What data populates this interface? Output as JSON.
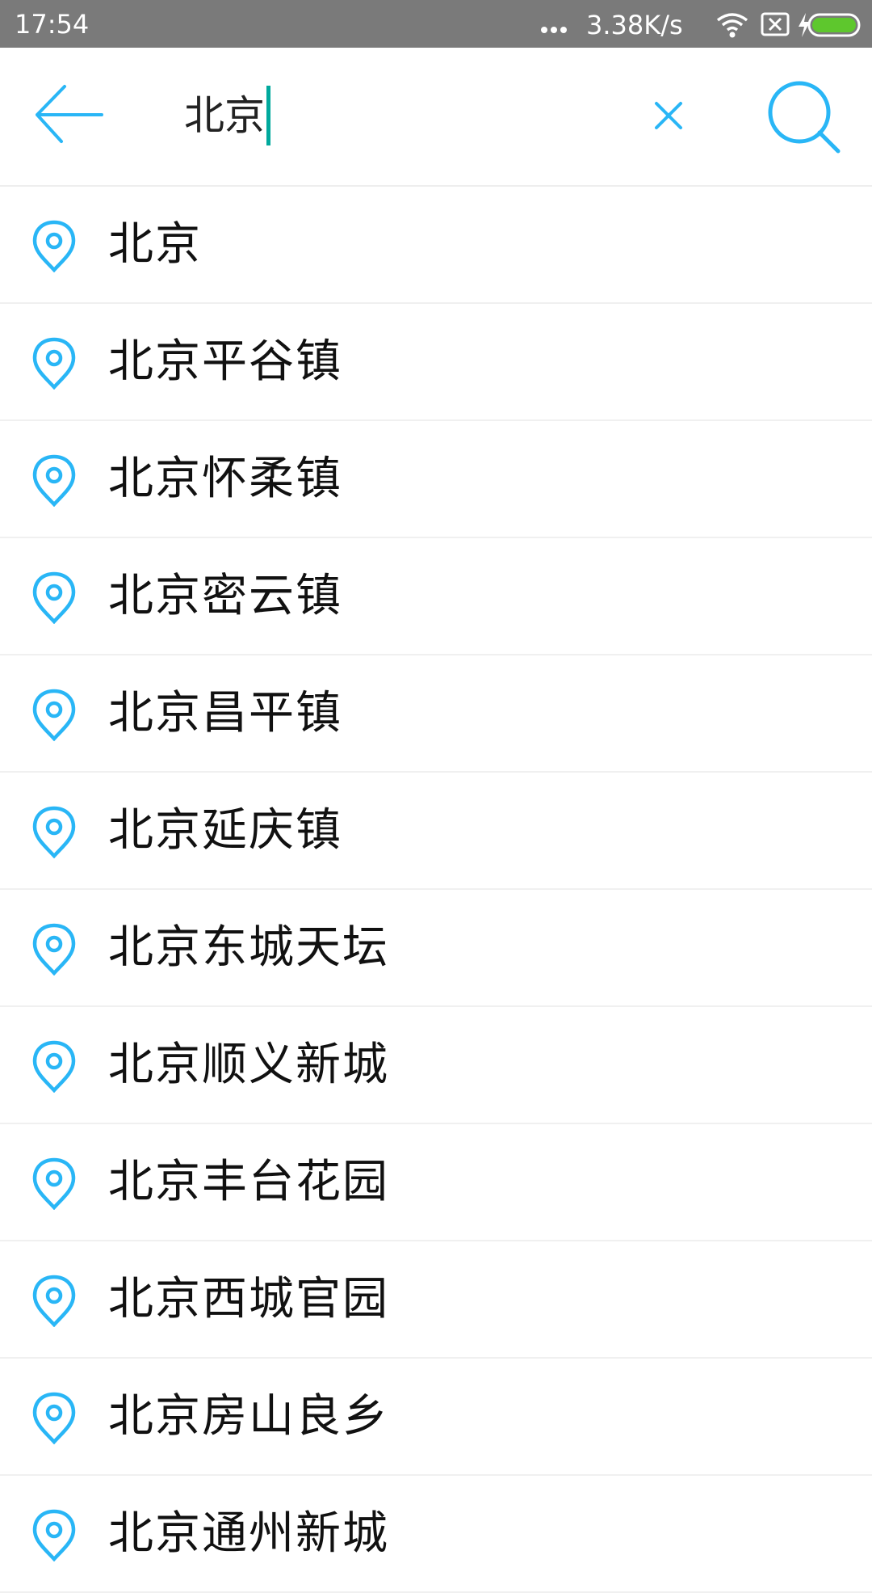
{
  "status_bar": {
    "time": "17:54",
    "network_speed": "3.38K/s",
    "icons": [
      "more-dots-icon",
      "wifi-icon",
      "sim-no-signal-icon",
      "charging-bolt-icon",
      "battery-icon"
    ],
    "battery_color": "#5ec72d"
  },
  "search": {
    "query": "北京",
    "back_icon": "arrow-left-icon",
    "clear_icon": "close-icon",
    "search_icon": "search-icon",
    "accent_color": "#29b6f6",
    "caret_color": "#00a99d"
  },
  "suggestions": [
    {
      "label": "北京",
      "icon": "location-pin-icon"
    },
    {
      "label": "北京平谷镇",
      "icon": "location-pin-icon"
    },
    {
      "label": "北京怀柔镇",
      "icon": "location-pin-icon"
    },
    {
      "label": "北京密云镇",
      "icon": "location-pin-icon"
    },
    {
      "label": "北京昌平镇",
      "icon": "location-pin-icon"
    },
    {
      "label": "北京延庆镇",
      "icon": "location-pin-icon"
    },
    {
      "label": "北京东城天坛",
      "icon": "location-pin-icon"
    },
    {
      "label": "北京顺义新城",
      "icon": "location-pin-icon"
    },
    {
      "label": "北京丰台花园",
      "icon": "location-pin-icon"
    },
    {
      "label": "北京西城官园",
      "icon": "location-pin-icon"
    },
    {
      "label": "北京房山良乡",
      "icon": "location-pin-icon"
    },
    {
      "label": "北京通州新城",
      "icon": "location-pin-icon"
    }
  ]
}
